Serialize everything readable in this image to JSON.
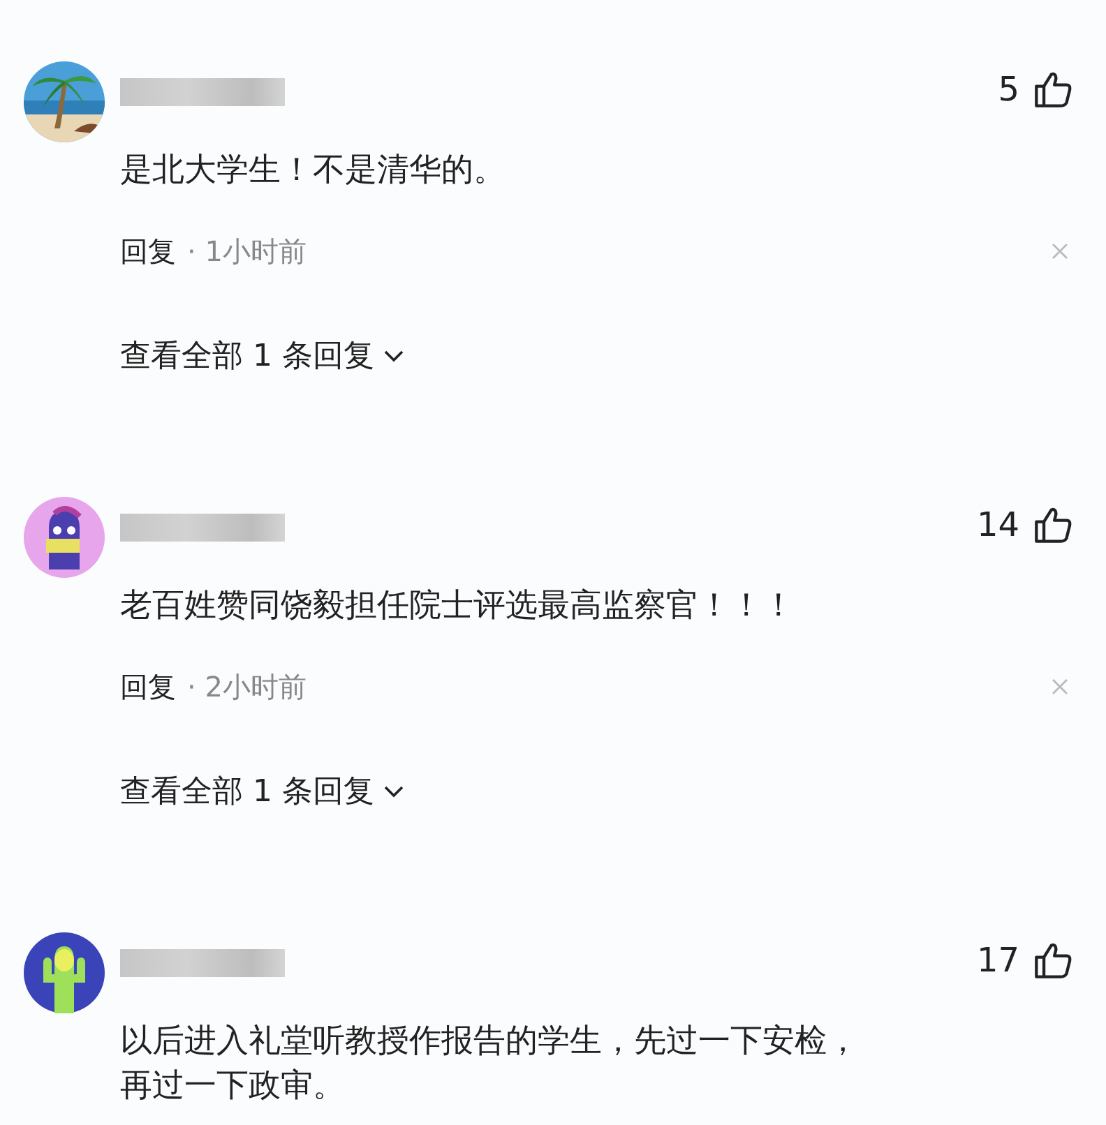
{
  "comments": [
    {
      "likes": "5",
      "text": "是北大学生！不是清华的。",
      "reply_label": "回复",
      "time": "· 1小时前",
      "view_replies": "查看全部 1 条回复"
    },
    {
      "avatar": {
        "kind": "character"
      },
      "likes": "14",
      "text": "老百姓赞同饶毅担任院士评选最高监察官！！！",
      "reply_label": "回复",
      "time": "· 2小时前",
      "view_replies": "查看全部 1 条回复"
    },
    {
      "avatar": {
        "kind": "cactus"
      },
      "likes": "17",
      "text": "以后进入礼堂听教授作报告的学生，先过一下安检，再过一下政审。"
    }
  ]
}
